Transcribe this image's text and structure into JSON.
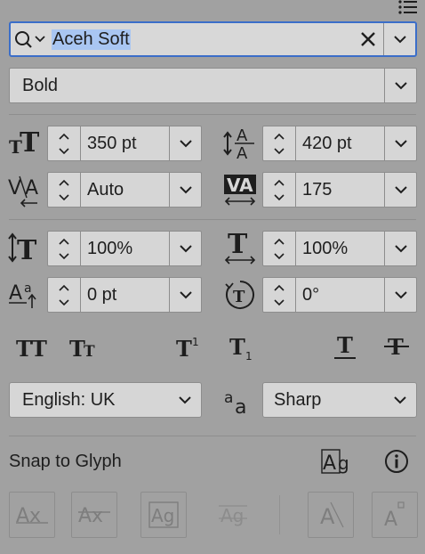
{
  "font_family": {
    "value": "Aceh Soft"
  },
  "font_style": {
    "value": "Bold"
  },
  "font_size": {
    "value": "350 pt"
  },
  "leading": {
    "value": "420 pt"
  },
  "kerning": {
    "value": "Auto"
  },
  "tracking": {
    "value": "175"
  },
  "vertical_scale": {
    "value": "100%"
  },
  "horizontal_scale": {
    "value": "100%"
  },
  "baseline_shift": {
    "value": "0 pt"
  },
  "character_rotation": {
    "value": "0°"
  },
  "language": {
    "value": "English: UK"
  },
  "anti_aliasing": {
    "value": "Sharp"
  },
  "snap": {
    "label": "Snap to Glyph"
  },
  "colors": {
    "background": "#a1a1a1",
    "field": "#d6d6d6",
    "focus": "#3b6ec9",
    "selection": "#a9c6f2"
  }
}
